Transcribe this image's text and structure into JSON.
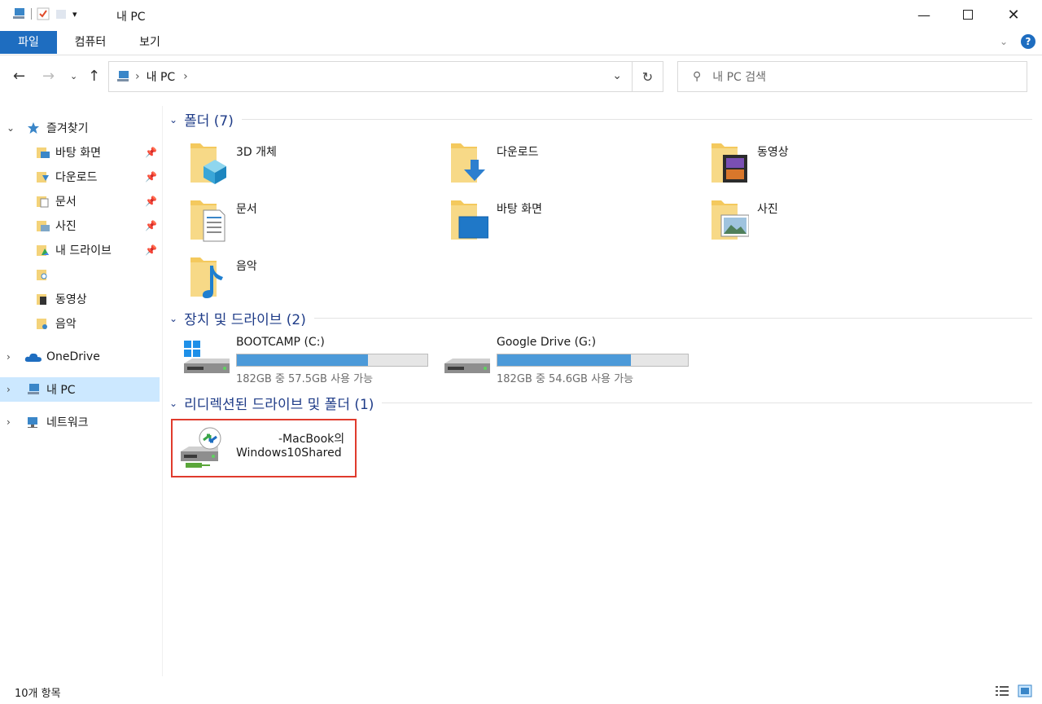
{
  "window": {
    "title": "내 PC"
  },
  "ribbon": {
    "tabs": [
      "파일",
      "컴퓨터",
      "보기"
    ]
  },
  "address": {
    "crumb": "내 PC"
  },
  "search": {
    "placeholder": "내 PC 검색"
  },
  "nav": {
    "quick_access": "즐겨찾기",
    "quick_items": [
      "바탕 화면",
      "다운로드",
      "문서",
      "사진",
      "내 드라이브",
      "",
      "동영상",
      "음악"
    ],
    "onedrive": "OneDrive",
    "this_pc": "내 PC",
    "network": "네트워크"
  },
  "groups": {
    "folders_title": "폴더 (7)",
    "drives_title": "장치 및 드라이브 (2)",
    "redirected_title": "리디렉션된 드라이브 및 폴더 (1)"
  },
  "folders": [
    "3D 개체",
    "다운로드",
    "동영상",
    "문서",
    "바탕 화면",
    "사진",
    "음악"
  ],
  "drives": [
    {
      "name": "BOOTCAMP (C:)",
      "info": "182GB 중 57.5GB 사용 가능",
      "used_fraction": 0.69
    },
    {
      "name": "Google Drive (G:)",
      "info": "182GB 중 54.6GB 사용 가능",
      "used_fraction": 0.7
    }
  ],
  "redirected": {
    "line1": "-MacBook의",
    "line2": "Windows10Shared"
  },
  "status": {
    "count": "10개 항목"
  },
  "colors": {
    "accent": "#1e6dc0",
    "selection": "#cce8ff",
    "bar_fill": "#4c9ad9",
    "highlight_box": "#e03b2d",
    "group_title": "#1f3c88"
  }
}
